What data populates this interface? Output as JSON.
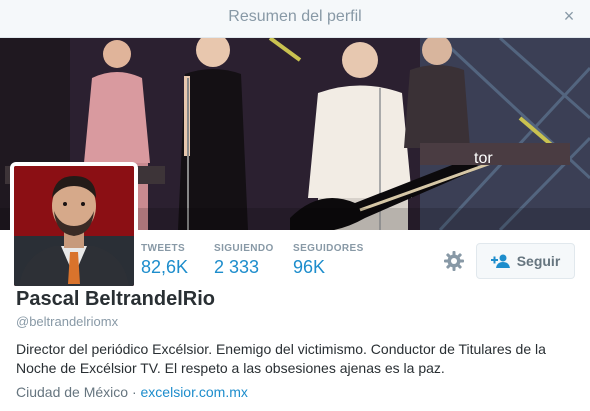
{
  "modal": {
    "title": "Resumen del perfil",
    "close_glyph": "×"
  },
  "banner": {
    "description_icon": "header-photo",
    "sign_text": "tor"
  },
  "avatar": {
    "icon": "profile-photo"
  },
  "stats": [
    {
      "label": "TWEETS",
      "value": "82,6K"
    },
    {
      "label": "SIGUIENDO",
      "value": "2 333"
    },
    {
      "label": "SEGUIDORES",
      "value": "96K"
    }
  ],
  "actions": {
    "settings_icon": "gear-icon",
    "follow_label": "Seguir",
    "follow_icon": "add-user-icon"
  },
  "profile": {
    "name": "Pascal BeltrandelRio",
    "handle": "@beltrandelriomx",
    "bio": "Director del periódico Excélsior. Enemigo del victimismo. Conductor de Titulares de la Noche de Excélsior TV. El respeto a las obsesiones ajenas es la paz.",
    "location": "Ciudad de México",
    "separator": "·",
    "url": "excelsior.com.mx"
  },
  "colors": {
    "link": "#1d8dcc",
    "muted": "#8899a6",
    "text": "#292f33",
    "avatar_bg": "#8b0f14"
  }
}
